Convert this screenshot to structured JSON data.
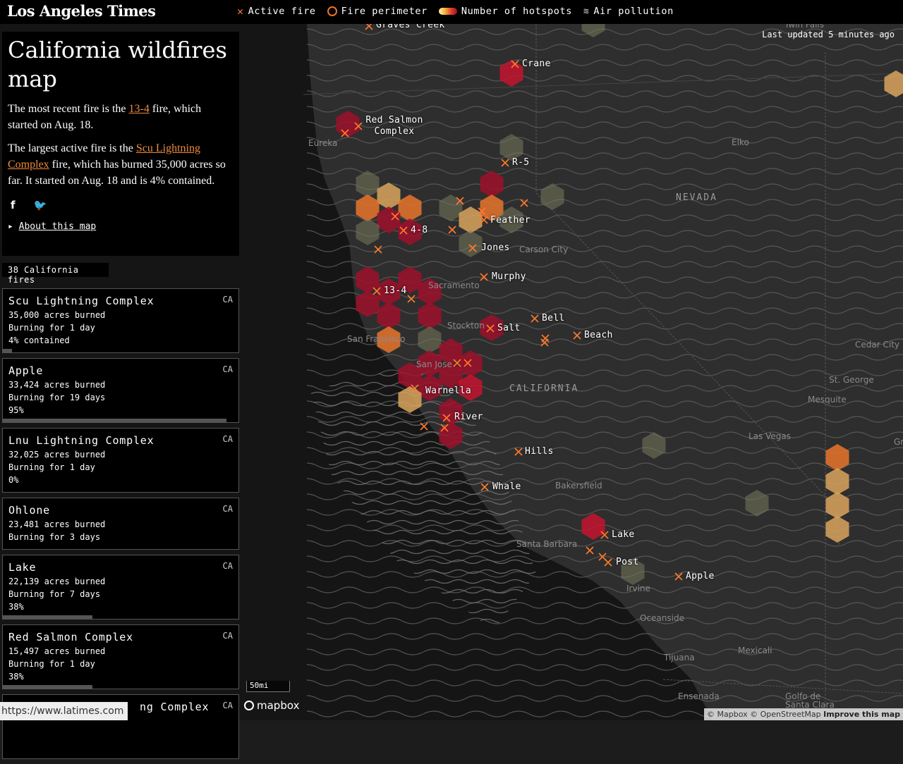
{
  "header": {
    "logo": "Los Angeles Times",
    "legend": [
      {
        "icon": "x-icon",
        "label": "Active fire"
      },
      {
        "icon": "circle-outline-icon",
        "label": "Fire perimeter"
      },
      {
        "icon": "gradient-icon",
        "label": "Number of hotspots"
      },
      {
        "icon": "wave-icon",
        "label": "Air pollution"
      }
    ]
  },
  "info": {
    "title": "California wildfires map",
    "recent_pre": "The most recent fire is the ",
    "recent_link": "13-4",
    "recent_post": " fire, which started on Aug. 18.",
    "largest_pre": "The largest active fire is the ",
    "largest_link": "Scu Lightning Complex",
    "largest_post": " fire, which has burned 35,000 acres so far. It started on Aug. 18 and is 4% contained.",
    "facebook": "f",
    "twitter": "t",
    "about": "About this map"
  },
  "fire_count": "38 California fires",
  "fires": [
    {
      "name": "Scu Lightning Complex",
      "state": "CA",
      "acres": "35,000 acres burned",
      "burning": "Burning for 1 day",
      "contained": "4% contained",
      "pct": 4
    },
    {
      "name": "Apple",
      "state": "CA",
      "acres": "33,424 acres burned",
      "burning": "Burning for 19 days",
      "contained": "95%",
      "pct": 95
    },
    {
      "name": "Lnu Lightning Complex",
      "state": "CA",
      "acres": "32,025 acres burned",
      "burning": "Burning for 1 day",
      "contained": "0%",
      "pct": 0
    },
    {
      "name": "Ohlone",
      "state": "CA",
      "acres": "23,481 acres burned",
      "burning": "Burning for 3 days",
      "contained": "",
      "pct": 0
    },
    {
      "name": "Lake",
      "state": "CA",
      "acres": "22,139 acres burned",
      "burning": "Burning for 7 days",
      "contained": "38%",
      "pct": 38
    },
    {
      "name": "Red Salmon Complex",
      "state": "CA",
      "acres": "15,497 acres burned",
      "burning": "Burning for 1 day",
      "contained": "38%",
      "pct": 38
    },
    {
      "name": "ng Complex",
      "state": "CA",
      "acres": "",
      "burning": "",
      "contained": "",
      "pct": 0
    }
  ],
  "map": {
    "updated": "Last updated 5 minutes ago",
    "scale": "50mi",
    "mapbox": "mapbox",
    "attribution": "© Mapbox © OpenStreetMap",
    "improve": "Improve this map",
    "url": "https://www.latimes.com",
    "states": [
      "NEVADA",
      "CALIFORNIA"
    ],
    "cities": [
      "Eureka",
      "Elko",
      "Twin Falls",
      "Carson City",
      "Sacramento",
      "Stockton",
      "San Francisco",
      "San Jose",
      "Cedar City",
      "St. George",
      "Mesquite",
      "Las Vegas",
      "Gr",
      "Bakersfield",
      "Santa Barbara",
      "Irvine",
      "Oceanside",
      "Mexicali",
      "Tijuana",
      "Ensenada",
      "Golfo de Santa Clara"
    ],
    "fire_labels": [
      "Graves Creek",
      "Crane",
      "Red Salmon Complex",
      "R-5",
      "4-8",
      "Feather",
      "Jones",
      "Murphy",
      "13-4",
      "Bell",
      "Salt",
      "Beach",
      "Warnella",
      "River",
      "Hills",
      "Whale",
      "Lake",
      "Post",
      "Apple"
    ]
  },
  "colors": {
    "accent": "#f08a3c",
    "hex_dark": "#9c0f2a",
    "hex_red": "#c3142f",
    "hex_orange": "#e8742c",
    "hex_tan": "#d9a35c",
    "hex_gray": "#7a7a5e"
  }
}
